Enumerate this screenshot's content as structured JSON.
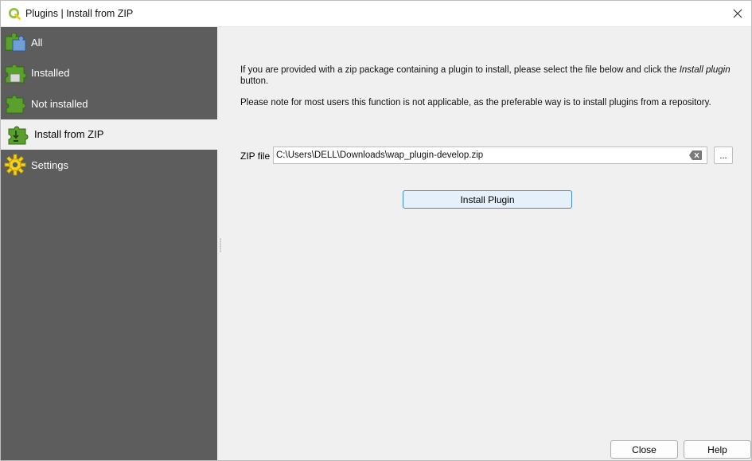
{
  "window": {
    "title": "Plugins | Install from ZIP",
    "close_icon": "close-icon"
  },
  "sidebar": {
    "items": [
      {
        "label": "All",
        "icon": "puzzle-all-icon",
        "active": false
      },
      {
        "label": "Installed",
        "icon": "puzzle-installed-icon",
        "active": false
      },
      {
        "label": "Not installed",
        "icon": "puzzle-not-installed-icon",
        "active": false
      },
      {
        "label": "Install from ZIP",
        "icon": "puzzle-zip-icon",
        "active": true
      },
      {
        "label": "Settings",
        "icon": "gear-icon",
        "active": false
      }
    ]
  },
  "content": {
    "intro_before": "If you are provided with a zip package containing a plugin to install, please select the file below and click the ",
    "intro_emphasis": "Install plugin",
    "intro_after": "button.",
    "note": "Please note for most users this function is not applicable, as the preferable way is to install plugins from a repository.",
    "zip_label": "ZIP file",
    "zip_value": "C:\\Users\\DELL\\Downloads\\wap_plugin-develop.zip",
    "browse_label": "...",
    "install_label": "Install Plugin"
  },
  "footer": {
    "close_label": "Close",
    "help_label": "Help"
  },
  "colors": {
    "sidebar_bg": "#5d5d5d",
    "accent": "#3c8ad8",
    "puzzle_green": "#5aa02c",
    "gear_yellow": "#f2d21b"
  }
}
